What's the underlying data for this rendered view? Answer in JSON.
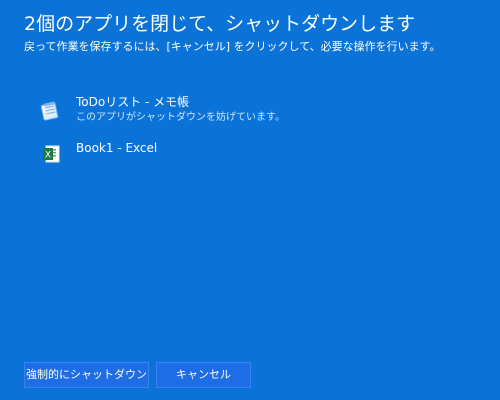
{
  "window": {
    "title": "2個のアプリを閉じて、シャットダウンします",
    "subtitle": "戻って作業を保存するには、[キャンセル] をクリックして、必要な操作を行います。"
  },
  "apps": [
    {
      "name": "ToDoリスト - メモ帳",
      "status": "このアプリがシャットダウンを妨げています。",
      "icon": "notepad-icon"
    },
    {
      "name": "Book1 - Excel",
      "status": "",
      "icon": "excel-icon"
    }
  ],
  "buttons": {
    "force_shutdown": "強制的にシャットダウン",
    "cancel": "キャンセル"
  },
  "colors": {
    "background": "#0b73d8",
    "button": "#1f6de6",
    "button_border": "#3b83f0",
    "secondary_text": "#cfe6ff"
  }
}
